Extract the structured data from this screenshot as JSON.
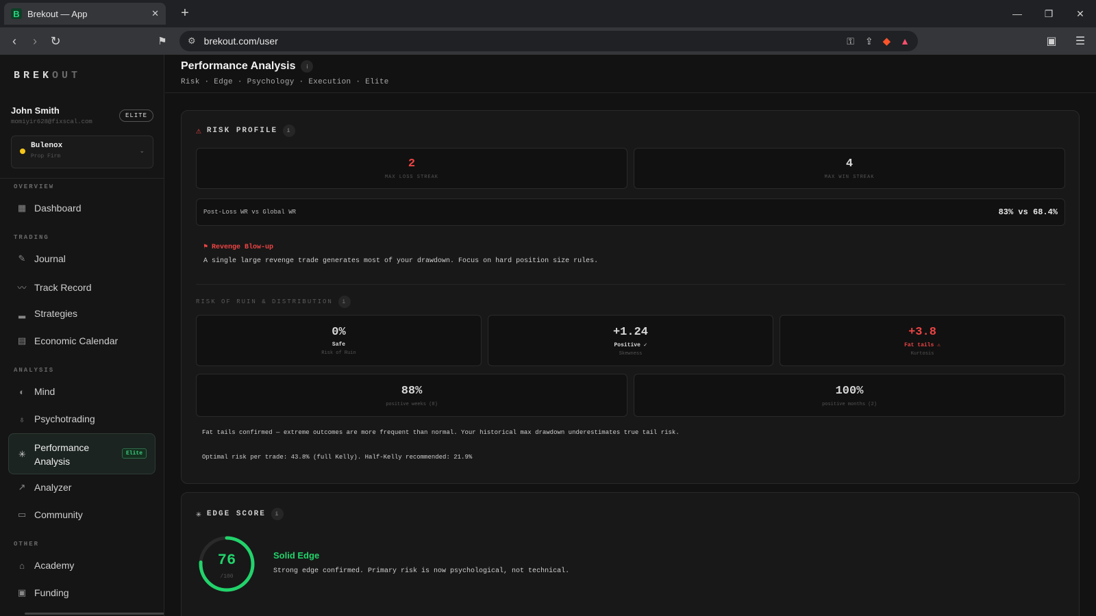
{
  "browser": {
    "tab_title": "Brekout — App",
    "favicon_letter": "B",
    "url": "brekout.com/user"
  },
  "sidebar": {
    "logo_main": "BREK",
    "logo_dim": "OUT",
    "user_name": "John Smith",
    "user_email": "momiyir628@fixscal.com",
    "plan_badge": "ELITE",
    "firm_name": "Bulenox",
    "firm_type": "Prop Firm",
    "sections": {
      "overview": "OVERVIEW",
      "trading": "TRADING",
      "analysis": "ANALYSIS",
      "other": "OTHER"
    },
    "items": {
      "dashboard": "Dashboard",
      "journal": "Journal",
      "track_record": "Track Record",
      "strategies": "Strategies",
      "economic_calendar": "Economic Calendar",
      "mind": "Mind",
      "psychotrading": "Psychotrading",
      "performance_analysis": "Performance Analysis",
      "performance_badge": "Elite",
      "analyzer": "Analyzer",
      "community": "Community",
      "academy": "Academy",
      "funding": "Funding"
    }
  },
  "header": {
    "title": "Performance Analysis",
    "breadcrumbs": "Risk · Edge · Psychology · Execution · Elite"
  },
  "risk": {
    "title": "RISK PROFILE",
    "max_loss_streak": "2",
    "max_loss_streak_label": "MAX LOSS STREAK",
    "max_win_streak": "4",
    "max_win_streak_label": "MAX WIN STREAK",
    "post_loss_label": "Post-Loss WR vs Global WR",
    "post_loss_value": "83% vs 68.4%",
    "alert_title": "Revenge Blow-up",
    "alert_text": "A single large revenge trade generates most of your drawdown. Focus on hard position size rules.",
    "ruin_title": "RISK OF RUIN & DISTRIBUTION",
    "ruin_value": "0%",
    "ruin_status": "Safe",
    "ruin_label": "Risk of Ruin",
    "skew_value": "+1.24",
    "skew_status": "Positive ✓",
    "skew_label": "Skewness",
    "kurt_value": "+3.8",
    "kurt_status": "Fat tails ⚠",
    "kurt_label": "Kurtosis",
    "weeks_value": "88%",
    "weeks_label": "positive weeks (8)",
    "months_value": "100%",
    "months_label": "positive months (2)",
    "note_fat_tails": "Fat tails confirmed — extreme outcomes are more frequent than normal. Your historical max drawdown underestimates true tail risk.",
    "note_kelly": "Optimal risk per trade: 43.8% (full Kelly). Half-Kelly recommended: 21.9%"
  },
  "edge": {
    "title": "EDGE SCORE",
    "score": "76",
    "score_max": "/100",
    "score_fraction": 0.76,
    "verdict": "Solid Edge",
    "description": "Strong edge confirmed. Primary risk is now psychological, not technical."
  },
  "colors": {
    "accent_green": "#22d36b",
    "danger_red": "#ef4444",
    "firm_dot": "#f5c518"
  }
}
